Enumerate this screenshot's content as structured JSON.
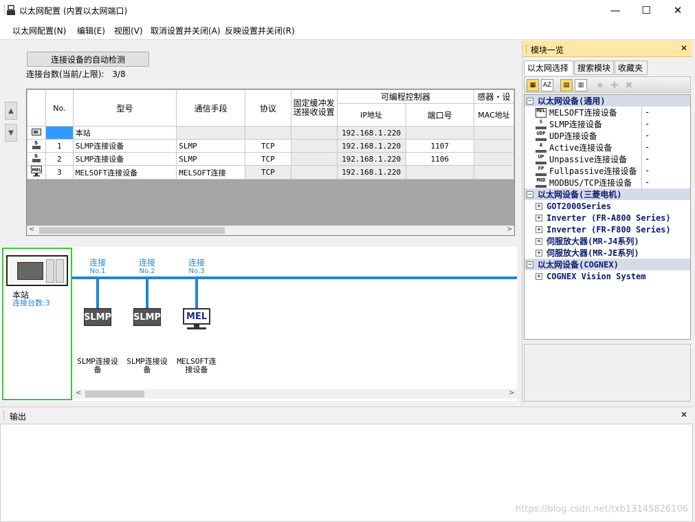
{
  "window": {
    "title": "以太网配置 (内置以太网端口)",
    "minimize": "—",
    "maximize": "☐",
    "close": "✕"
  },
  "menu": [
    "以太网配置(N)",
    "编辑(E)",
    "视图(V)",
    "取消设置并关闭(A)",
    "反映设置并关闭(R)"
  ],
  "top": {
    "detect_button": "连接设备的自动检测",
    "count_label": "连接台数(当前/上限):",
    "count_value": "3/8"
  },
  "table": {
    "headers": {
      "no": "No.",
      "model": "型号",
      "comm": "通信手段",
      "protocol": "协议",
      "fixed_buffer_1": "固定缓冲发",
      "fixed_buffer_2": "送接收设置",
      "plc_group": "可编程控制器",
      "ip": "IP地址",
      "port": "端口号",
      "sensor_group": "感器・设",
      "mac": "MAC地址"
    },
    "rows": [
      {
        "no": "",
        "model": "本站",
        "comm": "",
        "protocol": "",
        "ip": "192.168.1.220",
        "port": "",
        "icon": "station-icon"
      },
      {
        "no": "1",
        "model": "SLMP连接设备",
        "comm": "SLMP",
        "protocol": "TCP",
        "ip": "192.168.1.220",
        "port": "1107",
        "icon": "slmp-icon"
      },
      {
        "no": "2",
        "model": "SLMP连接设备",
        "comm": "SLMP",
        "protocol": "TCP",
        "ip": "192.168.1.220",
        "port": "1106",
        "icon": "slmp-icon"
      },
      {
        "no": "3",
        "model": "MELSOFT连接设备",
        "comm": "MELSOFT连接",
        "protocol": "TCP",
        "ip": "192.168.1.220",
        "port": "",
        "icon": "mel-icon"
      }
    ]
  },
  "network": {
    "station_name": "本站",
    "station_count": "连接台数:3",
    "connections": [
      {
        "label": "连接",
        "no": "No.1",
        "device": "SLMP",
        "name_1": "SLMP连接设",
        "name_2": "备"
      },
      {
        "label": "连接",
        "no": "No.2",
        "device": "SLMP",
        "name_1": "SLMP连接设",
        "name_2": "备"
      },
      {
        "label": "连接",
        "no": "No.3",
        "device": "MEL",
        "name_1": "MELSOFT连",
        "name_2": "接设备"
      }
    ]
  },
  "module_panel": {
    "title": "模块一览",
    "close": "✕",
    "tabs": [
      "以太网选择",
      "搜索模块",
      "收藏夹"
    ],
    "groups": [
      {
        "label": "以太网设备(通用)",
        "items": [
          {
            "icon": "MEL",
            "label": "MELSOFT连接设备",
            "value": "-"
          },
          {
            "icon": "S",
            "label": "SLMP连接设备",
            "value": "-"
          },
          {
            "icon": "UDP",
            "label": "UDP连接设备",
            "value": "-"
          },
          {
            "icon": "A",
            "label": "Active连接设备",
            "value": "-"
          },
          {
            "icon": "UP",
            "label": "Unpassive连接设备",
            "value": "-"
          },
          {
            "icon": "FP",
            "label": "Fullpassive连接设备",
            "value": "-"
          },
          {
            "icon": "MOD",
            "label": "MODBUS/TCP连接设备",
            "value": "-"
          }
        ]
      },
      {
        "label": "以太网设备(三菱电机)",
        "subs": [
          "GOT2000Series",
          "Inverter (FR-A800 Series)",
          "Inverter (FR-F800 Series)",
          "伺服放大器(MR-J4系列)",
          "伺服放大器(MR-JE系列)"
        ]
      },
      {
        "label": "以太网设备(COGNEX)",
        "subs": [
          "COGNEX Vision System"
        ]
      }
    ]
  },
  "output": {
    "title": "输出",
    "close": "✕"
  },
  "watermark": "https://blog.csdn.net/txb13145826106",
  "colors": {
    "accent": "#1e86d8",
    "selection_border": "#33cc33",
    "panel_title_bg": "#ffe8a6",
    "group_bg": "#d6dbe9"
  }
}
